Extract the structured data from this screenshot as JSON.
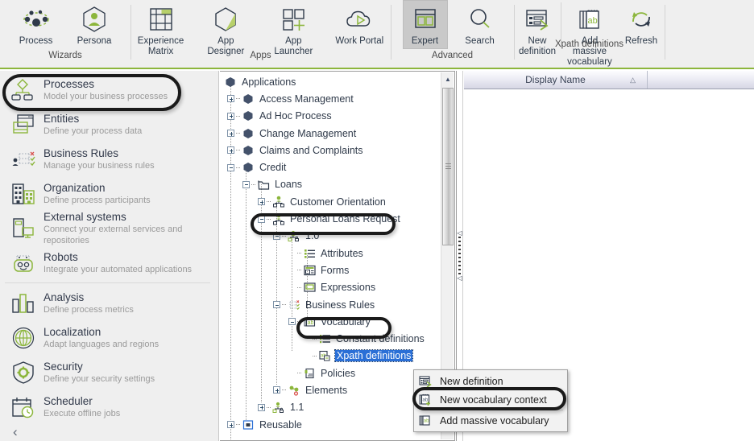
{
  "colors": {
    "accent_green": "#8cb63c",
    "ribbon_bg": "#efefef",
    "text_dark": "#2f3a4a",
    "text_muted": "#9a9a9a",
    "selection_blue": "#2a6fd6",
    "annotation_black": "#1a1a1a"
  },
  "ribbon": {
    "groups": [
      {
        "label": "Wizards",
        "buttons": [
          {
            "label": "Process",
            "icon": "process-nodes-icon",
            "active": false
          },
          {
            "label": "Persona",
            "icon": "persona-hexagon-icon",
            "active": false
          }
        ]
      },
      {
        "label": "Apps",
        "buttons": [
          {
            "label": "Experience\nMatrix",
            "label_line1": "Experience",
            "label_line2": "Matrix",
            "icon": "experience-matrix-icon",
            "active": false
          },
          {
            "label": "App Designer",
            "icon": "app-designer-hexagon-icon",
            "active": false
          },
          {
            "label": "App Launcher",
            "icon": "app-launcher-icon",
            "active": false
          },
          {
            "label": "Work Portal",
            "icon": "work-portal-cloud-icon",
            "active": false
          }
        ]
      },
      {
        "label": "Advanced",
        "buttons": [
          {
            "label": "Expert",
            "icon": "expert-window-icon",
            "active": true
          },
          {
            "label": "Search",
            "icon": "search-icon",
            "active": false
          }
        ]
      },
      {
        "label": "Xpath definitions",
        "buttons": [
          {
            "label_line1": "New",
            "label_line2": "definition",
            "icon": "new-definition-icon",
            "active": false
          },
          {
            "label_line1": "Add massive",
            "label_line2": "vocabulary",
            "icon": "add-massive-vocabulary-icon",
            "active": false
          },
          {
            "label_line1": "Refresh",
            "label_line2": "",
            "icon": "refresh-icon",
            "active": false
          }
        ]
      }
    ]
  },
  "sidebar": {
    "items": [
      {
        "title": "Processes",
        "subtitle": "Model your business processes",
        "icon": "process-tree-icon",
        "highlighted": true
      },
      {
        "title": "Entities",
        "subtitle": "Define your process data",
        "icon": "entities-window-icon",
        "highlighted": false
      },
      {
        "title": "Business Rules",
        "subtitle": "Manage your business rules",
        "icon": "business-rules-icon",
        "highlighted": false
      },
      {
        "title": "Organization",
        "subtitle": "Define process participants",
        "icon": "organization-building-icon",
        "highlighted": false
      },
      {
        "title": "External systems",
        "subtitle": "Connect your external services and repositories",
        "icon": "external-systems-icon",
        "highlighted": false
      },
      {
        "title": "Robots",
        "subtitle": "Integrate your automated applications",
        "icon": "robot-icon",
        "highlighted": false
      },
      {
        "title": "Analysis",
        "subtitle": "Define  process  metrics",
        "icon": "analysis-bars-icon",
        "highlighted": false
      },
      {
        "title": "Localization",
        "subtitle": "Adapt languages  and regions",
        "icon": "localization-globe-icon",
        "highlighted": false
      },
      {
        "title": "Security",
        "subtitle": "Define  your  security  settings",
        "icon": "security-shield-icon",
        "highlighted": false
      },
      {
        "title": "Scheduler",
        "subtitle": "Execute offline  jobs",
        "icon": "scheduler-calendar-icon",
        "highlighted": false
      }
    ],
    "collapse_glyph": "‹"
  },
  "tree": {
    "nodes": [
      {
        "label": "Applications",
        "depth": 0,
        "expander": "none",
        "icon": "application-hex-icon"
      },
      {
        "label": "Access Management",
        "depth": 1,
        "expander": "plus",
        "icon": "application-hex-icon"
      },
      {
        "label": "Ad Hoc Process",
        "depth": 1,
        "expander": "plus",
        "icon": "application-hex-icon"
      },
      {
        "label": "Change Management",
        "depth": 1,
        "expander": "plus",
        "icon": "application-hex-icon"
      },
      {
        "label": "Claims and Complaints",
        "depth": 1,
        "expander": "plus",
        "icon": "application-hex-icon"
      },
      {
        "label": "Credit",
        "depth": 1,
        "expander": "minus",
        "icon": "application-hex-icon"
      },
      {
        "label": "Loans",
        "depth": 2,
        "expander": "minus",
        "icon": "folder-icon"
      },
      {
        "label": "Customer Orientation",
        "depth": 3,
        "expander": "plus",
        "icon": "process-person-icon"
      },
      {
        "label": "Personal Loans Request",
        "depth": 3,
        "expander": "minus",
        "icon": "process-person-icon",
        "highlighted": true
      },
      {
        "label": "1.0",
        "depth": 4,
        "expander": "minus",
        "icon": "version-lock-icon"
      },
      {
        "label": "Attributes",
        "depth": 5,
        "expander": "none",
        "icon": "attributes-list-icon"
      },
      {
        "label": "Forms",
        "depth": 5,
        "expander": "none",
        "icon": "forms-icon"
      },
      {
        "label": "Expressions",
        "depth": 5,
        "expander": "none",
        "icon": "expressions-icon"
      },
      {
        "label": "Business Rules",
        "depth": 5,
        "expander": "minus",
        "icon": "business-rules-small-icon"
      },
      {
        "label": "Vocabulary",
        "depth": 6,
        "expander": "minus",
        "icon": "vocabulary-ab-icon",
        "highlighted": true
      },
      {
        "label": "Constant definitions",
        "depth": 7,
        "expander": "none",
        "icon": "constant-definitions-icon"
      },
      {
        "label": "Xpath definitions",
        "depth": 7,
        "expander": "none",
        "icon": "xpath-definitions-icon",
        "selected": true
      },
      {
        "label": "Policies",
        "depth": 6,
        "expander": "none",
        "icon": "policies-icon"
      },
      {
        "label": "Elements",
        "depth": 5,
        "expander": "plus",
        "icon": "elements-icon"
      },
      {
        "label": "1.1",
        "depth": 4,
        "expander": "plus",
        "icon": "version-lock-icon"
      },
      {
        "label": "Reusable",
        "depth": 2,
        "expander": "plus",
        "icon": "reusable-icon"
      }
    ]
  },
  "grid": {
    "columns": [
      {
        "label": "Display Name",
        "sort": "△"
      },
      {
        "label": ""
      }
    ],
    "rows": []
  },
  "context_menu": {
    "items": [
      {
        "label": "New definition",
        "icon": "new-definition-menu-icon",
        "highlighted": false,
        "separator_after": false
      },
      {
        "label": "New vocabulary context",
        "icon": "new-vocabulary-context-icon",
        "highlighted": true,
        "separator_after": true
      },
      {
        "label": "Add massive vocabulary",
        "icon": "add-massive-vocabulary-menu-icon",
        "highlighted": false,
        "separator_after": false
      }
    ]
  }
}
